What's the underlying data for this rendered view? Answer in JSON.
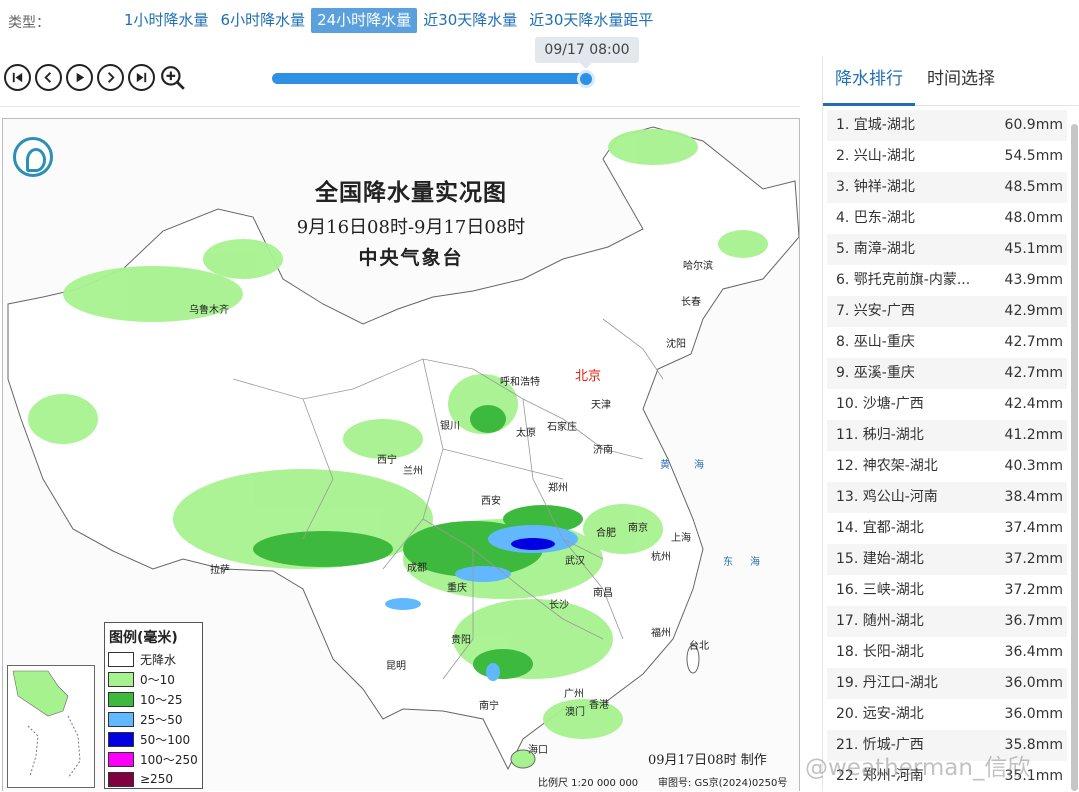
{
  "typebar": {
    "label": "类型：",
    "tabs": [
      "1小时降水量",
      "6小时降水量",
      "24小时降水量",
      "近30天降水量",
      "近30天降水量距平"
    ],
    "active_index": 2
  },
  "timeline": {
    "time": "09/17 08:00",
    "progress": 1.0
  },
  "map": {
    "title": "全国降水量实况图",
    "period": "9月16日08时-9月17日08时",
    "agency": "中央气象台",
    "capital": "北京",
    "cities": [
      "乌鲁木齐",
      "哈尔滨",
      "长春",
      "沈阳",
      "呼和浩特",
      "天津",
      "银川",
      "太原",
      "石家庄",
      "济南",
      "西宁",
      "兰州",
      "郑州",
      "西安",
      "南京",
      "上海",
      "合肥",
      "杭州",
      "成都",
      "武汉",
      "重庆",
      "拉萨",
      "长沙",
      "南昌",
      "福州",
      "贵阳",
      "台北",
      "昆明",
      "广州",
      "南宁",
      "澳门",
      "香港",
      "海口"
    ],
    "seas": [
      "黄",
      "海",
      "东",
      "海"
    ],
    "legend": {
      "title": "图例(毫米)",
      "items": [
        {
          "label": "无降水",
          "color": "#ffffff"
        },
        {
          "label": "0～10",
          "color": "#a6f28f"
        },
        {
          "label": "10～25",
          "color": "#3dba3d"
        },
        {
          "label": "25～50",
          "color": "#61b8ff"
        },
        {
          "label": "50～100",
          "color": "#0000e1"
        },
        {
          "label": "100～250",
          "color": "#fa00fa"
        },
        {
          "label": "≥250",
          "color": "#800040"
        }
      ]
    },
    "made_note": "09月17日08时 制作",
    "scale": "比例尺 1:20 000 000",
    "review": "审图号: GS京(2024)0250号"
  },
  "panel": {
    "tabs": [
      "降水排行",
      "时间选择"
    ],
    "active_index": 0,
    "ranking": [
      {
        "name": "1. 宜城-湖北",
        "value": "60.9mm"
      },
      {
        "name": "2. 兴山-湖北",
        "value": "54.5mm"
      },
      {
        "name": "3. 钟祥-湖北",
        "value": "48.5mm"
      },
      {
        "name": "4. 巴东-湖北",
        "value": "48.0mm"
      },
      {
        "name": "5. 南漳-湖北",
        "value": "45.1mm"
      },
      {
        "name": "6. 鄂托克前旗-内蒙...",
        "value": "43.9mm"
      },
      {
        "name": "7. 兴安-广西",
        "value": "42.9mm"
      },
      {
        "name": "8. 巫山-重庆",
        "value": "42.7mm"
      },
      {
        "name": "9. 巫溪-重庆",
        "value": "42.7mm"
      },
      {
        "name": "10. 沙塘-广西",
        "value": "42.4mm"
      },
      {
        "name": "11. 秭归-湖北",
        "value": "41.2mm"
      },
      {
        "name": "12. 神农架-湖北",
        "value": "40.3mm"
      },
      {
        "name": "13. 鸡公山-河南",
        "value": "38.4mm"
      },
      {
        "name": "14. 宜都-湖北",
        "value": "37.4mm"
      },
      {
        "name": "15. 建始-湖北",
        "value": "37.2mm"
      },
      {
        "name": "16. 三峡-湖北",
        "value": "37.2mm"
      },
      {
        "name": "17. 随州-湖北",
        "value": "36.7mm"
      },
      {
        "name": "18. 长阳-湖北",
        "value": "36.4mm"
      },
      {
        "name": "19. 丹江口-湖北",
        "value": "36.0mm"
      },
      {
        "name": "20. 远安-湖北",
        "value": "36.0mm"
      },
      {
        "name": "21. 忻城-广西",
        "value": "35.8mm"
      },
      {
        "name": "22. 郑州-河南",
        "value": "35.1mm"
      }
    ]
  },
  "watermark": "@weatherman_信欣"
}
